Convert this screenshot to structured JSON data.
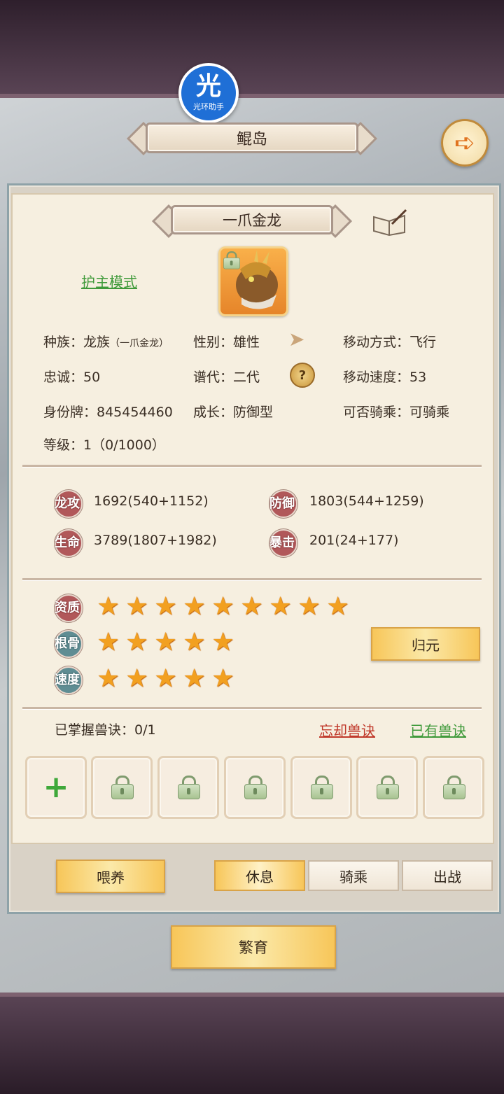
{
  "location": {
    "title": "鲲岛"
  },
  "helper_badge": {
    "glyph": "光",
    "label": "光环助手"
  },
  "pet": {
    "name": "一爪金龙",
    "mode_label": "护主模式",
    "info": {
      "race_label": "种族：龙族",
      "race_sub": "（一爪金龙）",
      "gender": "性别：雄性",
      "move_type": "移动方式：飞行",
      "loyalty": "忠诚：50",
      "generation": "谱代：二代",
      "move_speed": "移动速度：53",
      "id_tag": "身份牌：845454460",
      "growth": "成长：防御型",
      "rideable": "可否骑乘：可骑乘",
      "level": "等级：1（0/1000）"
    },
    "stats": [
      {
        "icon": "龙攻",
        "value": "1692(540+1152)"
      },
      {
        "icon": "防御",
        "value": "1803(544+1259)"
      },
      {
        "icon": "生命",
        "value": "3789(1807+1982)"
      },
      {
        "icon": "暴击",
        "value": "201(24+177)"
      }
    ],
    "ratings": [
      {
        "label": "资质",
        "stars": 9
      },
      {
        "label": "根骨",
        "stars": 5
      },
      {
        "label": "速度",
        "stars": 5
      }
    ],
    "reset_button": "归元",
    "skills": {
      "count_label": "已掌握兽诀：0/1",
      "forget_link": "忘却兽诀",
      "owned_link": "已有兽诀",
      "add_symbol": "+"
    }
  },
  "actions": {
    "feed": "喂养",
    "rest": "休息",
    "ride": "骑乘",
    "battle": "出战",
    "breed": "繁育"
  },
  "colors": {
    "star": "#f2a020",
    "link_green": "#3f9a3a",
    "link_red": "#c0392b",
    "stat_red": "#b1585a",
    "stat_teal": "#5f8d93"
  }
}
